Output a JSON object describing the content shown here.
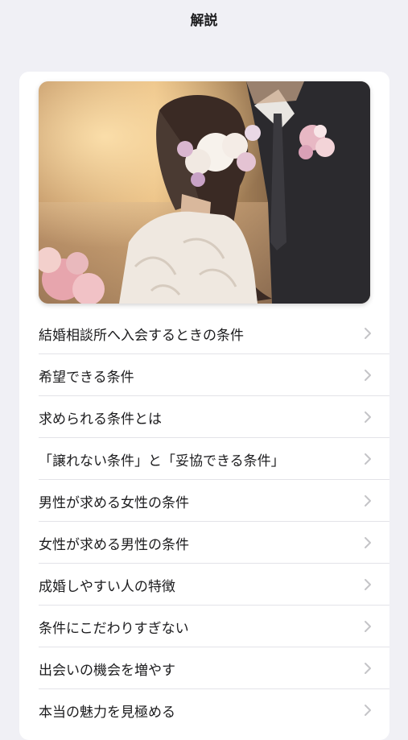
{
  "header": {
    "title": "解説"
  },
  "hero": {
    "icon": "wedding-couple-photo"
  },
  "menu": {
    "items": [
      {
        "label": "結婚相談所へ入会するときの条件"
      },
      {
        "label": "希望できる条件"
      },
      {
        "label": "求められる条件とは"
      },
      {
        "label": "「譲れない条件」と「妥協できる条件」"
      },
      {
        "label": "男性が求める女性の条件"
      },
      {
        "label": "女性が求める男性の条件"
      },
      {
        "label": "成婚しやすい人の特徴"
      },
      {
        "label": "条件にこだわりすぎない"
      },
      {
        "label": "出会いの機会を増やす"
      },
      {
        "label": "本当の魅力を見極める"
      }
    ],
    "chevron_icon": "chevron-right-icon"
  },
  "colors": {
    "background": "#f0f0f5",
    "card": "#ffffff",
    "text": "#1c1c1e",
    "chevron": "#c4c4c7",
    "divider": "#e3e3e8"
  }
}
